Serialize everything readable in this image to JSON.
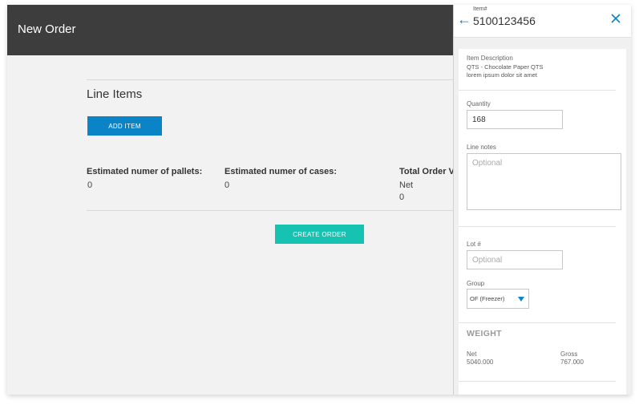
{
  "header": {
    "title": "New Order"
  },
  "main": {
    "section_title": "Line Items",
    "add_item_label": "ADD ITEM",
    "stats": [
      {
        "label": "Estimated numer of pallets:",
        "value": "0"
      },
      {
        "label": "Estimated numer of cases:",
        "value": "0"
      },
      {
        "label": "Total Order V",
        "sublabel": "Net",
        "value": "0"
      }
    ],
    "create_order_label": "CREATE ORDER"
  },
  "panel": {
    "item_label": "Item#",
    "item_number": "5100123456",
    "description_label": "Item Description",
    "description_line1": "QTS - Chocolate Paper QTS",
    "description_line2": "lorem ipsum dolor sit amet",
    "quantity_label": "Quantity",
    "quantity_value": "168",
    "line_notes_label": "Line notes",
    "line_notes_placeholder": "Optional",
    "lot_label": "Lot #",
    "lot_placeholder": "Optional",
    "group_label": "Group",
    "group_value": "OF (Freezer)",
    "weight_title": "WEIGHT",
    "net_label": "Net",
    "net_value": "5040.000",
    "gross_label": "Gross",
    "gross_value": "767.000"
  },
  "colors": {
    "primary": "#0a84c6",
    "accent": "#16c3b3",
    "header_bg": "#3d3d3d"
  },
  "icons": {
    "back": "arrow-left-icon",
    "close": "close-icon",
    "dropdown": "caret-down-icon"
  }
}
